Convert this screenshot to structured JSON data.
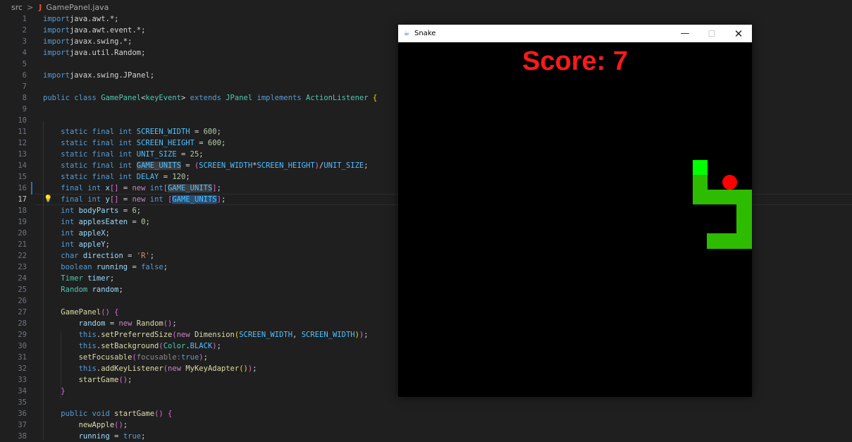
{
  "breadcrumb": {
    "folder": "src",
    "separator": ">",
    "file_icon": "J",
    "file": "GamePanel.java"
  },
  "editor": {
    "active_line": 17,
    "lines": [
      {
        "n": "1"
      },
      {
        "n": "2"
      },
      {
        "n": "3"
      },
      {
        "n": "4"
      },
      {
        "n": "5"
      },
      {
        "n": "6"
      },
      {
        "n": "7"
      },
      {
        "n": "8"
      },
      {
        "n": "9"
      },
      {
        "n": "10"
      },
      {
        "n": "11"
      },
      {
        "n": "12"
      },
      {
        "n": "13"
      },
      {
        "n": "14"
      },
      {
        "n": "15"
      },
      {
        "n": "16"
      },
      {
        "n": "17"
      },
      {
        "n": "18"
      },
      {
        "n": "19"
      },
      {
        "n": "20"
      },
      {
        "n": "21"
      },
      {
        "n": "22"
      },
      {
        "n": "23"
      },
      {
        "n": "24"
      },
      {
        "n": "25"
      },
      {
        "n": "26"
      },
      {
        "n": "27"
      },
      {
        "n": "28"
      },
      {
        "n": "29"
      },
      {
        "n": "30"
      },
      {
        "n": "31"
      },
      {
        "n": "32"
      },
      {
        "n": "33"
      },
      {
        "n": "34"
      },
      {
        "n": "35"
      },
      {
        "n": "36"
      },
      {
        "n": "37"
      },
      {
        "n": "38"
      }
    ],
    "code": [
      [
        [
          "kw",
          "import"
        ],
        [
          "",
          "java.awt.*;"
        ]
      ],
      [
        [
          "kw",
          "import"
        ],
        [
          "",
          "java.awt.event.*;"
        ]
      ],
      [
        [
          "kw",
          "import"
        ],
        [
          "",
          "javax.swing.*;"
        ]
      ],
      [
        [
          "kw",
          "import"
        ],
        [
          "",
          "java.util.Random;"
        ]
      ],
      [],
      [
        [
          "kw",
          "import"
        ],
        [
          "",
          "javax.swing.JPanel;"
        ]
      ],
      [],
      [
        [
          "kw",
          "public class "
        ],
        [
          "ty",
          "GamePanel"
        ],
        [
          "",
          "<"
        ],
        [
          "ty",
          "keyEvent"
        ],
        [
          "",
          "> "
        ],
        [
          "kw",
          "extends "
        ],
        [
          "ty",
          "JPanel "
        ],
        [
          "kw",
          "implements "
        ],
        [
          "ty",
          "ActionListener "
        ],
        [
          "br2",
          "{"
        ]
      ],
      [],
      [],
      [
        [
          "",
          "    "
        ],
        [
          "kw",
          "static final int "
        ],
        [
          "cst",
          "SCREEN_WIDTH"
        ],
        [
          "",
          " = "
        ],
        [
          "num",
          "600"
        ],
        [
          "",
          ";"
        ]
      ],
      [
        [
          "",
          "    "
        ],
        [
          "kw",
          "static final int "
        ],
        [
          "cst",
          "SCREEN_HEIGHT"
        ],
        [
          "",
          " = "
        ],
        [
          "num",
          "600"
        ],
        [
          "",
          ";"
        ]
      ],
      [
        [
          "",
          "    "
        ],
        [
          "kw",
          "static final int "
        ],
        [
          "cst",
          "UNIT_SIZE"
        ],
        [
          "",
          " = "
        ],
        [
          "num",
          "25"
        ],
        [
          "",
          ";"
        ]
      ],
      [
        [
          "",
          "    "
        ],
        [
          "kw",
          "static final int "
        ],
        [
          "cst hl2",
          "GAME_UNITS"
        ],
        [
          "",
          " = "
        ],
        [
          "br",
          "("
        ],
        [
          "cst",
          "SCREEN_WIDTH"
        ],
        [
          "",
          "*"
        ],
        [
          "cst",
          "SCREEN_HEIGHT"
        ],
        [
          "br",
          ")"
        ],
        [
          "",
          "/"
        ],
        [
          "cst",
          "UNIT_SIZE"
        ],
        [
          "",
          ";"
        ]
      ],
      [
        [
          "",
          "    "
        ],
        [
          "kw",
          "static final int "
        ],
        [
          "cst",
          "DELAY"
        ],
        [
          "",
          " = "
        ],
        [
          "num",
          "120"
        ],
        [
          "",
          ";"
        ]
      ],
      [
        [
          "",
          "    "
        ],
        [
          "kw",
          "final int "
        ],
        [
          "var",
          "x"
        ],
        [
          "br",
          "[]"
        ],
        [
          "",
          " = "
        ],
        [
          "kc",
          "new "
        ],
        [
          "kw",
          "int"
        ],
        [
          "br",
          "["
        ],
        [
          "cst hl2",
          "GAME_UNITS"
        ],
        [
          "br",
          "]"
        ],
        [
          "",
          ";"
        ]
      ],
      [
        [
          "",
          "    "
        ],
        [
          "kw",
          "final int "
        ],
        [
          "var",
          "y"
        ],
        [
          "br",
          "[]"
        ],
        [
          "",
          " = "
        ],
        [
          "kc",
          "new "
        ],
        [
          "kw",
          "int "
        ],
        [
          "br",
          "["
        ],
        [
          "cst hl",
          "GAME_UNITS"
        ],
        [
          "br",
          "]"
        ],
        [
          "",
          ";"
        ]
      ],
      [
        [
          "",
          "    "
        ],
        [
          "kw",
          "int "
        ],
        [
          "var",
          "bodyParts"
        ],
        [
          "",
          " = "
        ],
        [
          "num",
          "6"
        ],
        [
          "",
          ";"
        ]
      ],
      [
        [
          "",
          "    "
        ],
        [
          "kw",
          "int "
        ],
        [
          "var",
          "applesEaten"
        ],
        [
          "",
          " = "
        ],
        [
          "num",
          "0"
        ],
        [
          "",
          ";"
        ]
      ],
      [
        [
          "",
          "    "
        ],
        [
          "kw",
          "int "
        ],
        [
          "var",
          "appleX"
        ],
        [
          "",
          ";"
        ]
      ],
      [
        [
          "",
          "    "
        ],
        [
          "kw",
          "int "
        ],
        [
          "var",
          "appleY"
        ],
        [
          "",
          ";"
        ]
      ],
      [
        [
          "",
          "    "
        ],
        [
          "kw",
          "char "
        ],
        [
          "var",
          "direction"
        ],
        [
          "",
          " = "
        ],
        [
          "str",
          "'R'"
        ],
        [
          "",
          ";"
        ]
      ],
      [
        [
          "",
          "    "
        ],
        [
          "kw",
          "boolean "
        ],
        [
          "var",
          "running"
        ],
        [
          "",
          " = "
        ],
        [
          "kw",
          "false"
        ],
        [
          "",
          ";"
        ]
      ],
      [
        [
          "",
          "    "
        ],
        [
          "ty",
          "Timer "
        ],
        [
          "var",
          "timer"
        ],
        [
          "",
          ";"
        ]
      ],
      [
        [
          "",
          "    "
        ],
        [
          "ty",
          "Random "
        ],
        [
          "var",
          "random"
        ],
        [
          "",
          ";"
        ]
      ],
      [],
      [
        [
          "",
          "    "
        ],
        [
          "fn",
          "GamePanel"
        ],
        [
          "br",
          "() "
        ],
        [
          "br",
          "{"
        ]
      ],
      [
        [
          "",
          "        "
        ],
        [
          "var",
          "random"
        ],
        [
          "",
          " = "
        ],
        [
          "kc",
          "new "
        ],
        [
          "fn",
          "Random"
        ],
        [
          "br",
          "()"
        ],
        [
          "",
          ";"
        ]
      ],
      [
        [
          "",
          "        "
        ],
        [
          "kw",
          "this"
        ],
        [
          "",
          "."
        ],
        [
          "fn",
          "setPreferredSize"
        ],
        [
          "br",
          "("
        ],
        [
          "kc",
          "new "
        ],
        [
          "fn",
          "Dimension"
        ],
        [
          "br2",
          "("
        ],
        [
          "cst",
          "SCREEN_WIDTH"
        ],
        [
          "",
          ", "
        ],
        [
          "cst",
          "SCREEN_WIDTH"
        ],
        [
          "br2",
          ")"
        ],
        [
          "br",
          ")"
        ],
        [
          "",
          ";"
        ]
      ],
      [
        [
          "",
          "        "
        ],
        [
          "kw",
          "this"
        ],
        [
          "",
          "."
        ],
        [
          "fn",
          "setBackground"
        ],
        [
          "br",
          "("
        ],
        [
          "ty",
          "Color"
        ],
        [
          "",
          "."
        ],
        [
          "cst",
          "BLACK"
        ],
        [
          "br",
          ")"
        ],
        [
          "",
          ";"
        ]
      ],
      [
        [
          "",
          "        "
        ],
        [
          "fn",
          "setFocusable"
        ],
        [
          "br",
          "("
        ],
        [
          "hint",
          "focusable:"
        ],
        [
          "kw",
          "true"
        ],
        [
          "br",
          ")"
        ],
        [
          "",
          ";"
        ]
      ],
      [
        [
          "",
          "        "
        ],
        [
          "kw",
          "this"
        ],
        [
          "",
          "."
        ],
        [
          "fn",
          "addKeyListener"
        ],
        [
          "br",
          "("
        ],
        [
          "kc",
          "new "
        ],
        [
          "fn",
          "MyKeyAdapter"
        ],
        [
          "br2",
          "()"
        ],
        [
          "br",
          ")"
        ],
        [
          "",
          ";"
        ]
      ],
      [
        [
          "",
          "        "
        ],
        [
          "fn",
          "startGame"
        ],
        [
          "br",
          "()"
        ],
        [
          "",
          ";"
        ]
      ],
      [
        [
          "",
          "    "
        ],
        [
          "br",
          "}"
        ]
      ],
      [],
      [
        [
          "",
          "    "
        ],
        [
          "kw",
          "public void "
        ],
        [
          "fn",
          "startGame"
        ],
        [
          "br",
          "() "
        ],
        [
          "br",
          "{"
        ]
      ],
      [
        [
          "",
          "        "
        ],
        [
          "fn",
          "newApple"
        ],
        [
          "br",
          "()"
        ],
        [
          "",
          ";"
        ]
      ],
      [
        [
          "",
          "        "
        ],
        [
          "var",
          "running"
        ],
        [
          "",
          " = "
        ],
        [
          "kw",
          "true"
        ],
        [
          "",
          ";"
        ]
      ]
    ]
  },
  "window": {
    "title": "Snake",
    "app_icon": "java-cup-icon",
    "minimize": "—",
    "maximize": "☐",
    "close": "✕"
  },
  "game": {
    "score_label": "Score: 7",
    "score_value": 7,
    "colors": {
      "background": "#000000",
      "score": "#ff1a1a",
      "head": "#00ff00",
      "body": "#2dbc00",
      "apple": "#ff0000"
    }
  }
}
